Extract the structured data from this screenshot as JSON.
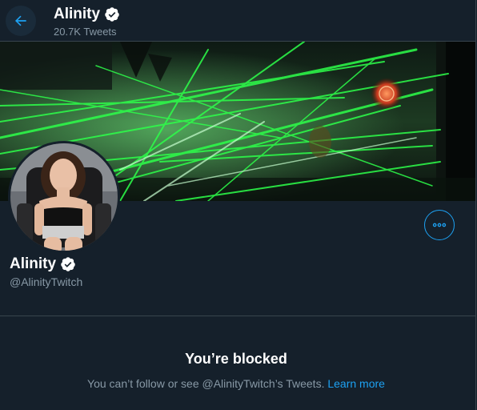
{
  "header": {
    "name": "Alinity",
    "tweet_count": "20.7K Tweets",
    "back_icon": "arrow-left-icon",
    "verified_icon": "verified-badge-icon"
  },
  "profile": {
    "name": "Alinity",
    "handle": "@AlinityTwitch",
    "more_icon": "more-options-icon"
  },
  "blocked": {
    "title": "You’re blocked",
    "message": "You can’t follow or see @AlinityTwitch’s Tweets.",
    "link": "Learn more"
  },
  "colors": {
    "background": "#15202b",
    "accent": "#1da1f2",
    "secondary_text": "#8899a6",
    "border": "#38444d"
  }
}
